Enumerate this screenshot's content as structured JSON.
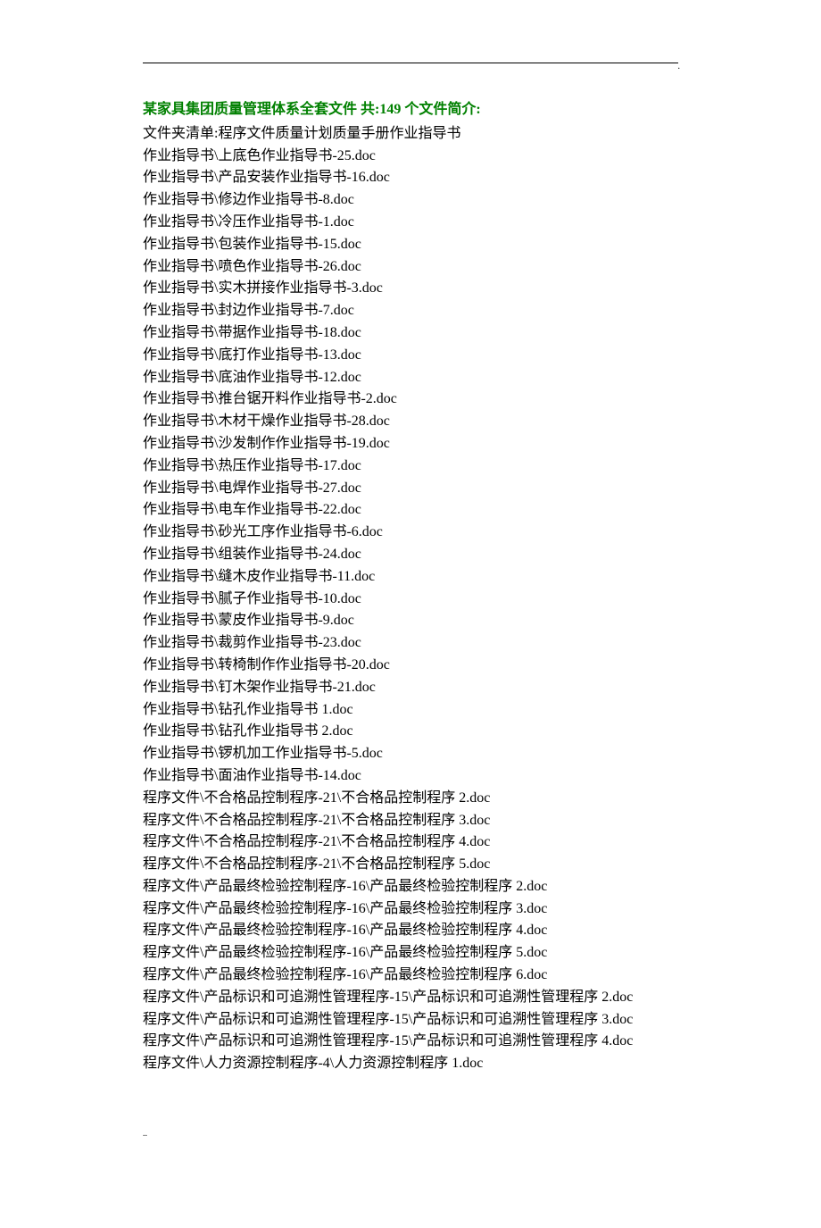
{
  "title_prefix": "某家具集团质量管理体系全套文件 共:",
  "title_count": "149",
  "title_suffix": " 个文件简介:",
  "folder_list_label": "文件夹清单:程序文件质量计划质量手册作业指导书",
  "lines": [
    "作业指导书\\上底色作业指导书-25.doc",
    "作业指导书\\产品安装作业指导书-16.doc",
    "作业指导书\\修边作业指导书-8.doc",
    "作业指导书\\冷压作业指导书-1.doc",
    "作业指导书\\包装作业指导书-15.doc",
    "作业指导书\\喷色作业指导书-26.doc",
    "作业指导书\\实木拼接作业指导书-3.doc",
    "作业指导书\\封边作业指导书-7.doc",
    "作业指导书\\带据作业指导书-18.doc",
    "作业指导书\\底打作业指导书-13.doc",
    "作业指导书\\底油作业指导书-12.doc",
    "作业指导书\\推台锯开料作业指导书-2.doc",
    "作业指导书\\木材干燥作业指导书-28.doc",
    "作业指导书\\沙发制作作业指导书-19.doc",
    "作业指导书\\热压作业指导书-17.doc",
    "作业指导书\\电焊作业指导书-27.doc",
    "作业指导书\\电车作业指导书-22.doc",
    "作业指导书\\砂光工序作业指导书-6.doc",
    "作业指导书\\组装作业指导书-24.doc",
    "作业指导书\\缝木皮作业指导书-11.doc",
    "作业指导书\\腻子作业指导书-10.doc",
    "作业指导书\\蒙皮作业指导书-9.doc",
    "作业指导书\\裁剪作业指导书-23.doc",
    "作业指导书\\转椅制作作业指导书-20.doc",
    "作业指导书\\钉木架作业指导书-21.doc",
    "作业指导书\\钻孔作业指导书 1.doc",
    "作业指导书\\钻孔作业指导书 2.doc",
    "作业指导书\\锣机加工作业指导书-5.doc",
    "作业指导书\\面油作业指导书-14.doc",
    "程序文件\\不合格品控制程序-21\\不合格品控制程序 2.doc",
    "程序文件\\不合格品控制程序-21\\不合格品控制程序 3.doc",
    "程序文件\\不合格品控制程序-21\\不合格品控制程序 4.doc",
    "程序文件\\不合格品控制程序-21\\不合格品控制程序 5.doc",
    "程序文件\\产品最终检验控制程序-16\\产品最终检验控制程序 2.doc",
    "程序文件\\产品最终检验控制程序-16\\产品最终检验控制程序 3.doc",
    "程序文件\\产品最终检验控制程序-16\\产品最终检验控制程序 4.doc",
    "程序文件\\产品最终检验控制程序-16\\产品最终检验控制程序 5.doc",
    "程序文件\\产品最终检验控制程序-16\\产品最终检验控制程序 6.doc",
    "程序文件\\产品标识和可追溯性管理程序-15\\产品标识和可追溯性管理程序 2.doc",
    "程序文件\\产品标识和可追溯性管理程序-15\\产品标识和可追溯性管理程序 3.doc",
    "程序文件\\产品标识和可追溯性管理程序-15\\产品标识和可追溯性管理程序 4.doc",
    "程序文件\\人力资源控制程序-4\\人力资源控制程序 1.doc"
  ],
  "footer_dots": ".."
}
